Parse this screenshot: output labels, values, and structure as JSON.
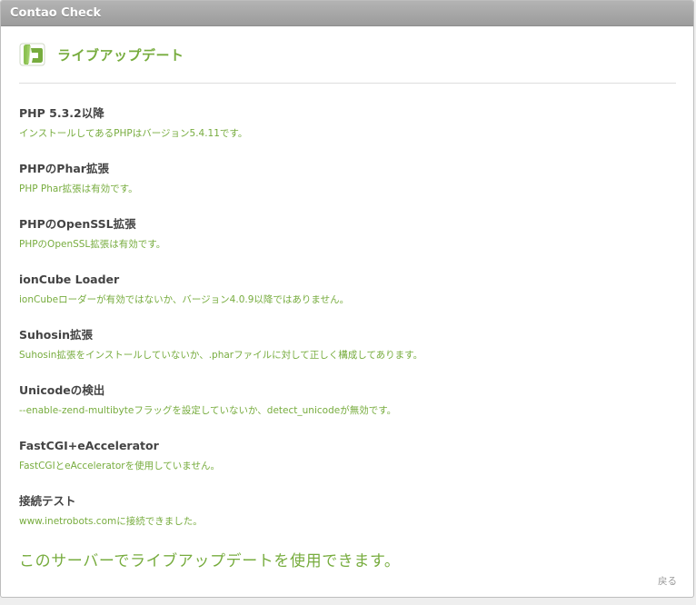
{
  "window": {
    "title": "Contao Check"
  },
  "header": {
    "title": "ライブアップデート",
    "icon": "contao-logo-icon"
  },
  "checks": [
    {
      "title": "PHP 5.3.2以降",
      "desc": "インストールしてあるPHPはバージョン5.4.11です。"
    },
    {
      "title": "PHPのPhar拡張",
      "desc": "PHP Phar拡張は有効です。"
    },
    {
      "title": "PHPのOpenSSL拡張",
      "desc": "PHPのOpenSSL拡張は有効です。"
    },
    {
      "title": "ionCube Loader",
      "desc": "ionCubeローダーが有効ではないか、バージョン4.0.9以降ではありません。"
    },
    {
      "title": "Suhosin拡張",
      "desc": "Suhosin拡張をインストールしていないか、.pharファイルに対して正しく構成してあります。"
    },
    {
      "title": "Unicodeの検出",
      "desc": "--enable-zend-multibyteフラッグを設定していないか、detect_unicodeが無効です。"
    },
    {
      "title": "FastCGI+eAccelerator",
      "desc": "FastCGIとeAcceleratorを使用していません。"
    },
    {
      "title": "接続テスト",
      "desc": "www.inetrobots.comに接続できました。"
    }
  ],
  "result": "このサーバーでライブアップデートを使用できます。",
  "back_label": "戻る",
  "colors": {
    "accent": "#77ac3e",
    "heading_text": "#444444",
    "titlebar": "#a8a8a8"
  }
}
